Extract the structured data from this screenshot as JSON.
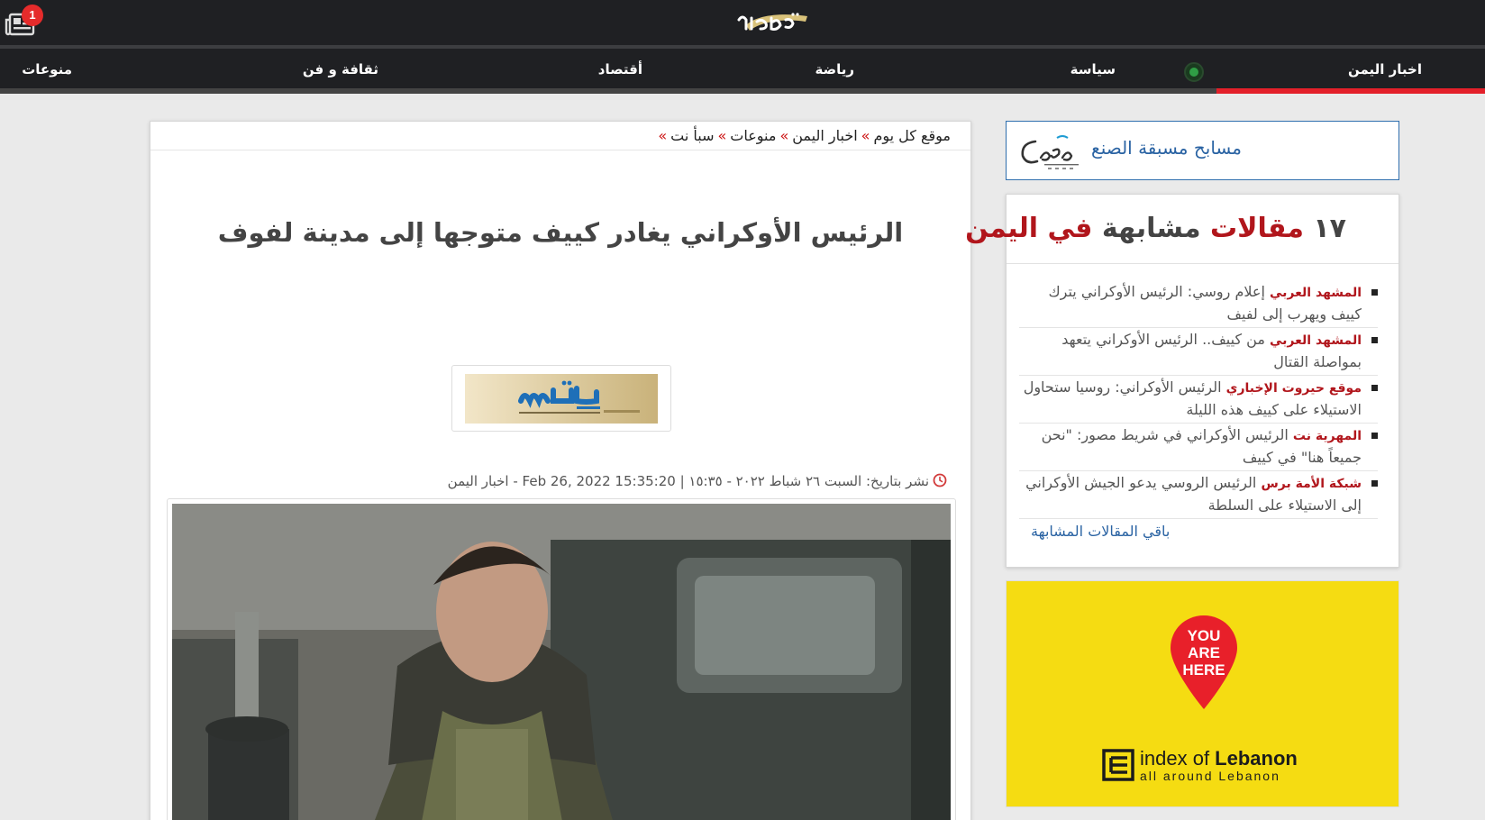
{
  "header": {
    "notification_count": "1"
  },
  "nav": {
    "items": [
      "اخبار اليمن",
      "سياسة",
      "رياضة",
      "أقتصاد",
      "ثقافة و فن",
      "منوعات"
    ]
  },
  "breadcrumb": {
    "items": [
      "موقع كل يوم",
      "اخبار اليمن",
      "منوعات",
      "سبأ نت"
    ]
  },
  "article": {
    "title": "الرئيس الأوكراني يغادر كييف متوجها إلى مدينة لفوف",
    "meta": "نشر بتاريخ:  السبت ٢٦ شباط ٢٠٢٢ - ١٥:٣٥ | Feb 26, 2022 15:35:20 - اخبار اليمن"
  },
  "sidebar": {
    "ad_pools_text": "مسابح مسبقة الصنع",
    "similar": {
      "title_count": "١٧",
      "title_word1": "مقالات",
      "title_word2": "مشابهة",
      "title_word3": "في اليمن",
      "items": [
        {
          "source": "المشهد العربي",
          "text": "إعلام روسي: الرئيس الأوكراني يترك كييف ويهرب إلى لفيف"
        },
        {
          "source": "المشهد العربي",
          "text": "من كييف.. الرئيس الأوكراني يتعهد بمواصلة القتال"
        },
        {
          "source": "موقع حيروت الإخباري",
          "text": "الرئيس الأوكراني: روسيا ستحاول الاستيلاء على كييف هذه الليلة"
        },
        {
          "source": "المهرية نت",
          "text": "الرئيس الأوكراني في شريط مصور: \"نحن جميعاً هنا\" في كييف"
        },
        {
          "source": "شبكة الأمة برس",
          "text": "الرئيس الروسي يدعو الجيش الأوكراني إلى الاستيلاء على السلطة"
        }
      ],
      "more_link": "باقي المقالات المشابهة"
    },
    "ad_lebanon": {
      "pin_line1": "YOU",
      "pin_line2": "ARE",
      "pin_line3": "HERE",
      "brand_prefix": "index of ",
      "brand_bold": "Lebanon",
      "tagline": "all around Lebanon"
    }
  }
}
